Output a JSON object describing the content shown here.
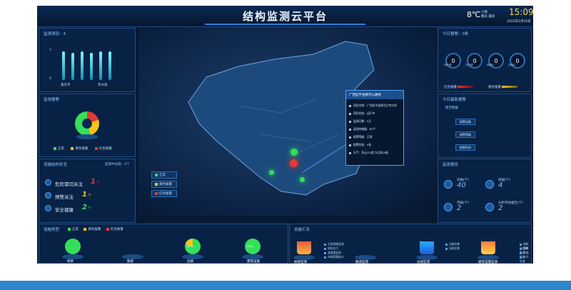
{
  "header": {
    "title": "结构监测云平台",
    "temp": "8℃",
    "weather": "小雨",
    "city": "重庆 晨间",
    "time": "15:09",
    "date": "2021年1月16日"
  },
  "left": {
    "monitor_title": "监测项目：4",
    "bars_y": [
      "1",
      "0"
    ],
    "bars_x": [
      "重庆市",
      "贵州省"
    ],
    "bars_values": [
      0.95,
      0.9,
      0.95,
      0.9,
      0.95,
      0.95
    ],
    "alarm_title": "监测报警",
    "alarm_legend": [
      "正常",
      "黄色报警",
      "红色报警"
    ],
    "safety_title": "设施结构安全",
    "safety_sub": "监测中设施：4个",
    "safety_items": [
      {
        "label": "危险需切关注",
        "value": "1",
        "unit": "个"
      },
      {
        "label": "预警关注",
        "value": "1",
        "unit": "个"
      },
      {
        "label": "安全健康",
        "value": "2",
        "unit": "个"
      }
    ]
  },
  "map": {
    "legend": [
      "正常",
      "黄色报警",
      "红色报警"
    ],
    "tooltip": {
      "title": "广西桂平金柳河公路桥",
      "rows": [
        "项目名称：广西桂平金柳河江特大桥",
        "项目状态：运行中",
        "监测天数：5天",
        "监测传感器：80个",
        "报警等级：正常",
        "报警状态：0条",
        "天气：多云/22度 东北风/4级"
      ]
    }
  },
  "right": {
    "today_title": "今日报警：0条",
    "rings": [
      {
        "value": "0",
        "label": "待处理"
      },
      {
        "value": "0",
        "label": "已处理"
      },
      {
        "value": "0",
        "label": "待确认"
      },
      {
        "value": "0",
        "label": "已确认"
      }
    ],
    "legend_red": "红色报警",
    "legend_yellow": "黄色报警",
    "latest_title": "今日最新报警",
    "tabs": [
      "暂无数据"
    ],
    "buttons": [
      "报警设备",
      "报警等级",
      "报警时间"
    ],
    "report_title": "监测报告",
    "reports": [
      {
        "label": "日报(个)",
        "value": "40"
      },
      {
        "label": "周报(个)",
        "value": "4"
      },
      {
        "label": "月报(个)",
        "value": "2"
      },
      {
        "label": "分析评估报告(个)",
        "value": "2"
      }
    ]
  },
  "bottom": {
    "type_title": "设施类型",
    "type_legend": [
      "正常",
      "黄色报警",
      "红色报警"
    ],
    "types": [
      "桥梁",
      "隧道",
      "边坡",
      "建筑设施"
    ],
    "type_pct": [
      "",
      "",
      "80%",
      "20%"
    ],
    "summary_title": "设施汇总",
    "summary": [
      "桥梁监测",
      "隧道监测",
      "边坡监测",
      "建筑设施监测"
    ],
    "summary_notes": [
      [
        "主梁挠度监测",
        "结构应力",
        "温湿度监测",
        "车辆荷载统计"
      ],
      [
        "边坡位移",
        "深部位移"
      ],
      [
        "倾斜与沉降",
        "裂缝监测",
        "风速风向",
        "应力应变"
      ]
    ]
  },
  "colors": {
    "bg": "#071a33",
    "accent": "#4ca3ff",
    "normal": "#34e05a",
    "yellow": "#f5c518",
    "red": "#e53935"
  }
}
